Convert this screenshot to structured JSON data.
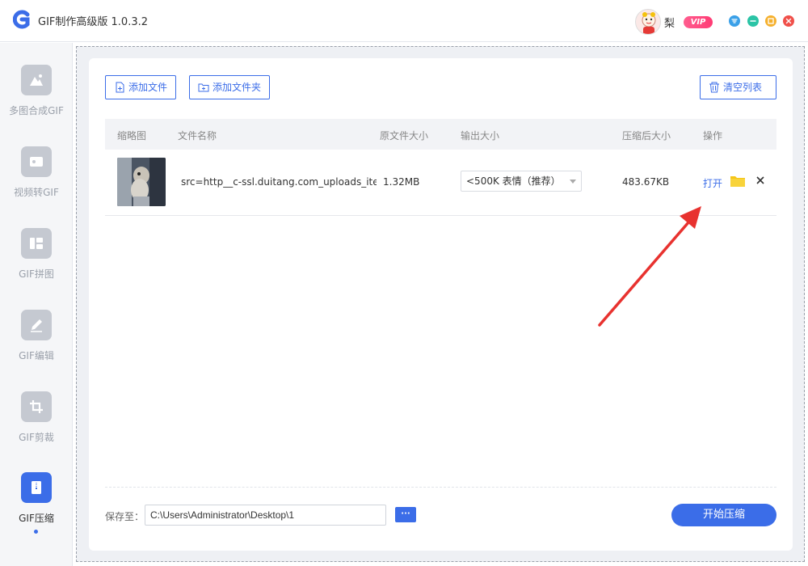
{
  "app": {
    "title": "GIF制作高级版 1.0.3.2"
  },
  "user": {
    "name": "梨",
    "vip_label": "VIP"
  },
  "colors": {
    "accent": "#3b6de8",
    "arrow": "#e8322f"
  },
  "sidebar": {
    "items": [
      {
        "label": "多图合成GIF",
        "icon": "mountain-image-icon"
      },
      {
        "label": "视频转GIF",
        "icon": "video-camera-icon"
      },
      {
        "label": "GIF拼图",
        "icon": "collage-icon"
      },
      {
        "label": "GIF编辑",
        "icon": "pencil-icon"
      },
      {
        "label": "GIF剪裁",
        "icon": "crop-icon"
      },
      {
        "label": "GIF压缩",
        "icon": "zip-file-icon",
        "active": true
      }
    ]
  },
  "toolbar": {
    "add_file": "添加文件",
    "add_folder": "添加文件夹",
    "clear_list": "清空列表"
  },
  "table": {
    "headers": [
      "缩略图",
      "文件名称",
      "原文件大小",
      "输出大小",
      "压缩后大小",
      "操作"
    ],
    "rows": [
      {
        "filename": "src=http__c-ssl.duitang.com_uploads_iter",
        "original_size": "1.32MB",
        "output_option": "<500K 表情（推荐）",
        "compressed_size": "483.67KB",
        "open_label": "打开"
      }
    ]
  },
  "footer": {
    "save_to_label": "保存至：",
    "save_path": "C:\\Users\\Administrator\\Desktop\\1",
    "browse_label": "···",
    "start_label": "开始压缩"
  }
}
